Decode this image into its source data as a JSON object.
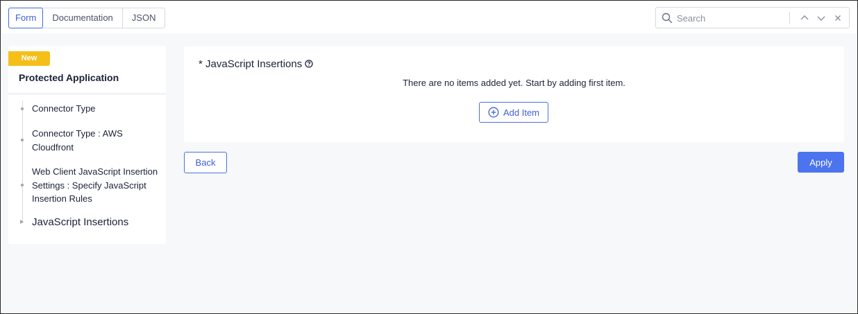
{
  "tabs": [
    {
      "label": "Form",
      "active": true
    },
    {
      "label": "Documentation",
      "active": false
    },
    {
      "label": "JSON",
      "active": false
    }
  ],
  "search": {
    "placeholder": "Search",
    "icon": "search-icon",
    "nav_icons": [
      "chevron-up-icon",
      "chevron-down-icon",
      "close-icon"
    ]
  },
  "sidebar": {
    "badge": "New",
    "title": "Protected Application",
    "items": [
      {
        "label": "Connector Type"
      },
      {
        "label": "Connector Type : AWS Cloudfront"
      },
      {
        "label": "Web Client JavaScript Insertion Settings : Specify JavaScript Insertion Rules"
      },
      {
        "label": "JavaScript Insertions",
        "current": true
      }
    ]
  },
  "main": {
    "field_label": "* JavaScript Insertions",
    "help_icon": "help-circle-icon",
    "empty_message": "There are no items added yet. Start by adding first item.",
    "add_button": "Add Item",
    "add_icon": "plus-circle-icon"
  },
  "footer": {
    "back_label": "Back",
    "apply_label": "Apply"
  },
  "colors": {
    "accent": "#4b74ee",
    "badge": "#f5bf19",
    "background": "#f7f8fa",
    "text": "#1b2238"
  }
}
